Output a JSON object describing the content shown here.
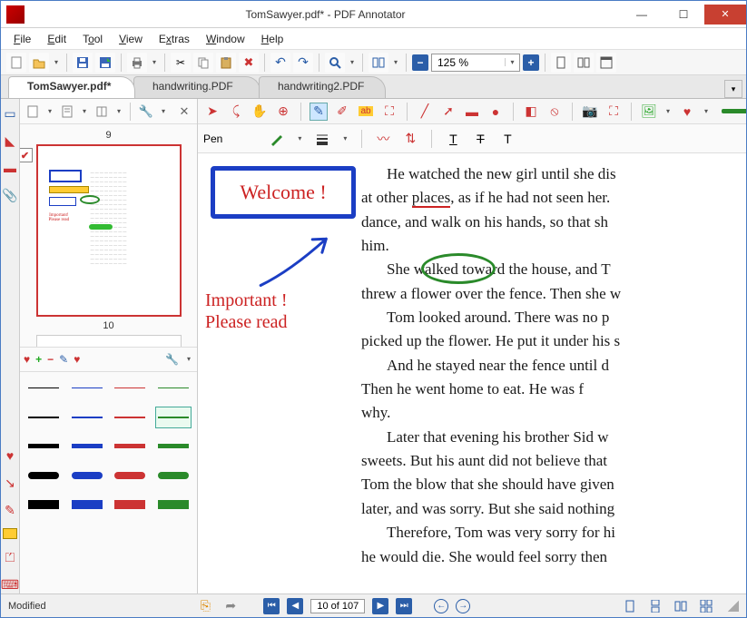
{
  "titlebar": {
    "title": "TomSawyer.pdf* - PDF Annotator"
  },
  "menu": {
    "file": "File",
    "edit": "Edit",
    "tool": "Tool",
    "view": "View",
    "extras": "Extras",
    "window": "Window",
    "help": "Help"
  },
  "toolbar": {
    "zoom_value": "125 %"
  },
  "tabs": {
    "t1": "TomSawyer.pdf*",
    "t2": "handwriting.PDF",
    "t3": "handwriting2.PDF"
  },
  "side": {
    "page_top": "9",
    "page_bottom": "10",
    "fav_plus": "+",
    "fav_minus": "−"
  },
  "ann_toolbar": {
    "tool_label": "Pen",
    "text_icons": [
      "T",
      "T",
      "T"
    ]
  },
  "document": {
    "p1": "He watched the new girl until she discovered him. Then he pretended he did not know she was there. He began to show off in all sorts of odd boyish ways.",
    "p1a": "at other ",
    "p1b": "places",
    "p1c": ", as if he had not seen her.",
    "p2": "dance, and walk on his hands, so that she",
    "p3": "him.",
    "p4a": "She ",
    "p4b": "walked",
    "p4c": " toward the house, and Tom",
    "p5": "threw a flower over the fence. Then she was gone.",
    "p6": "Tom looked around. There was no person near. He picked up the flower. He put it under his shirt next to his heart. And he stayed near the fence until dark. Then he went home to eat. He was full of happiness. His aunt wondered why.",
    "p7": "Later that evening his brother Sid went to get some sweets. But his aunt did not believe that Sid would. She gave Tom the blow that she should have given Sid. She discovered it later, and was sorry. But she said nothing about it to Tom.",
    "p8": "Therefore, Tom was very sorry for himself. He imagined he would die. She would feel sorry then. She would wish"
  },
  "annotations": {
    "welcome": "Welcome !",
    "important_l1": "Important !",
    "important_l2": "Please read"
  },
  "status": {
    "left": "Modified",
    "page_display": "10 of 107"
  }
}
